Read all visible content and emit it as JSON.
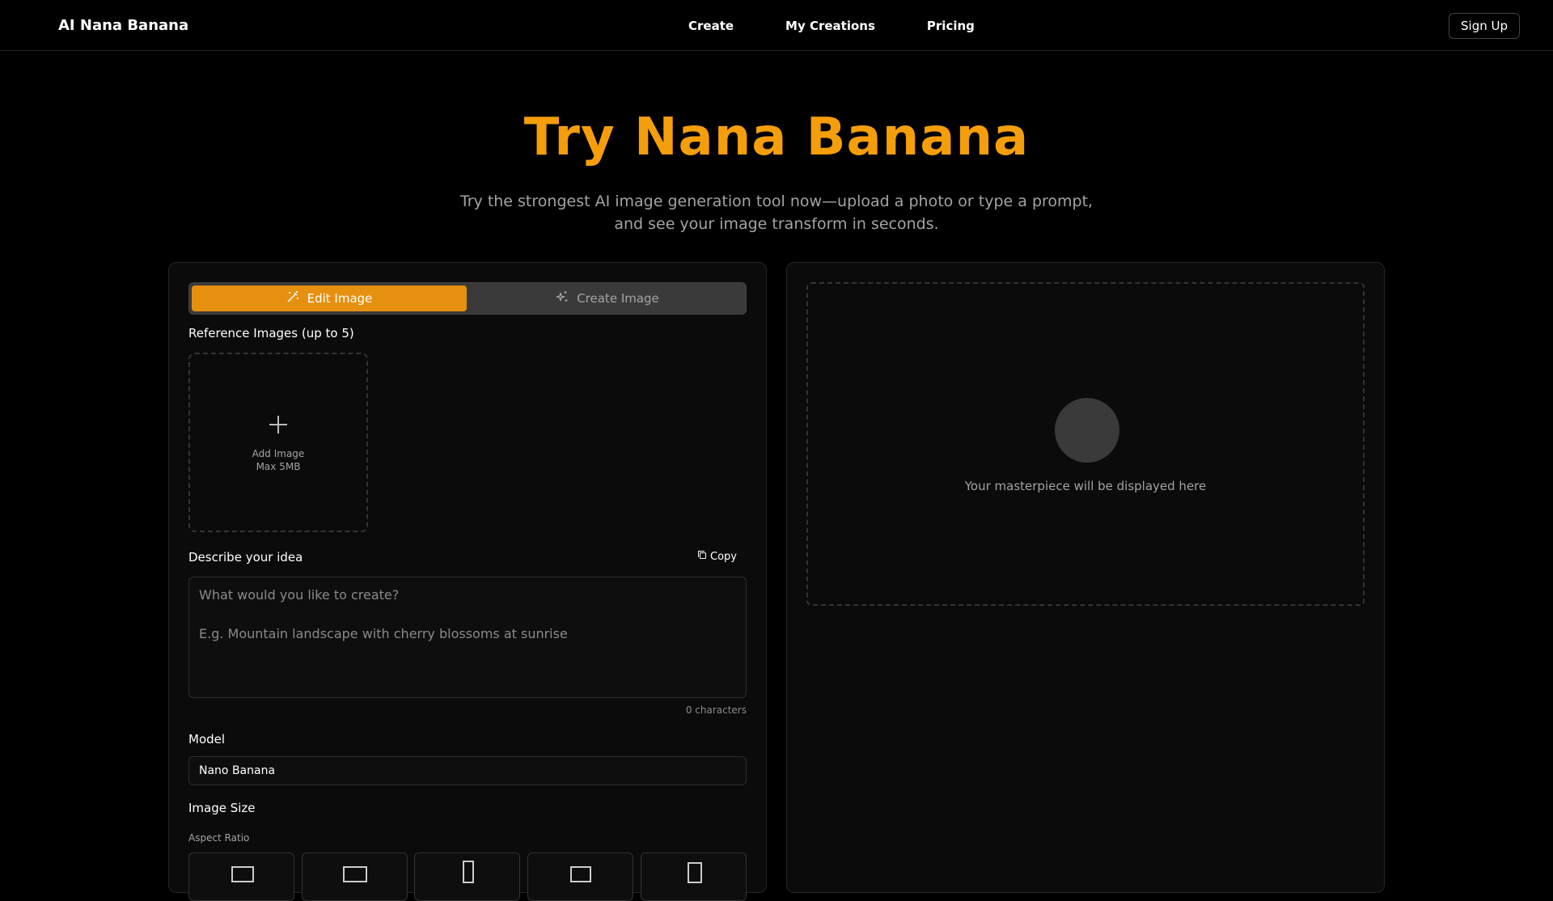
{
  "brand": {
    "name": "AI Nana Banana",
    "logo_icon": "banana-moon-icon",
    "accent": "#f59e0b"
  },
  "nav": {
    "create": "Create",
    "my_creations": "My Creations",
    "pricing": "Pricing"
  },
  "signup_label": "Sign Up",
  "hero": {
    "title": "Try Nana Banana",
    "subtitle_line1": "Try the strongest AI image generation tool now—upload a photo or type a prompt,",
    "subtitle_line2": "and see your image transform in seconds."
  },
  "tabs": {
    "edit": "Edit Image",
    "create": "Create Image",
    "active": "edit"
  },
  "reference": {
    "label": "Reference Images (up to 5)",
    "add_label": "Add Image",
    "max_label": "Max 5MB"
  },
  "prompt": {
    "label": "Describe your idea",
    "copy_label": "Copy",
    "placeholder": "What would you like to create?\n\nE.g. Mountain landscape with cherry blossoms at sunrise",
    "value": "",
    "char_count": "0 characters"
  },
  "model": {
    "label": "Model",
    "value": "Nano Banana"
  },
  "image_size": {
    "label": "Image Size",
    "aspect_label": "Aspect Ratio",
    "ratios": [
      "landscape",
      "landscape-wide",
      "portrait-tall",
      "landscape",
      "portrait"
    ]
  },
  "output": {
    "placeholder_text": "Your masterpiece will be displayed here"
  }
}
